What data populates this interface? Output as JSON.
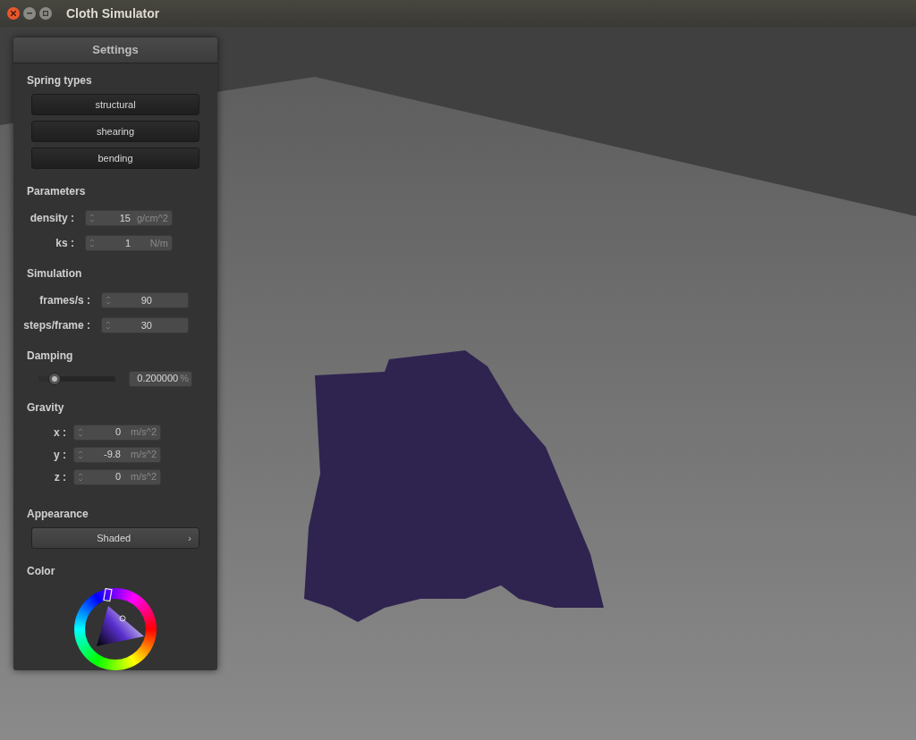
{
  "window": {
    "title": "Cloth Simulator"
  },
  "settings": {
    "title": "Settings",
    "spring_types": {
      "heading": "Spring types",
      "buttons": [
        "structural",
        "shearing",
        "bending"
      ]
    },
    "parameters": {
      "heading": "Parameters",
      "fields": [
        {
          "label": "density :",
          "value": "15",
          "unit": "g/cm^2"
        },
        {
          "label": "ks :",
          "value": "1",
          "unit": "N/m"
        }
      ]
    },
    "simulation": {
      "heading": "Simulation",
      "fields": [
        {
          "label": "frames/s :",
          "value": "90"
        },
        {
          "label": "steps/frame :",
          "value": "30"
        }
      ]
    },
    "damping": {
      "heading": "Damping",
      "level": 0.2,
      "value": "0.200000",
      "unit": "%"
    },
    "gravity": {
      "heading": "Gravity",
      "fields": [
        {
          "label": "x :",
          "value": "0",
          "unit": "m/s^2"
        },
        {
          "label": "y :",
          "value": "-9.8",
          "unit": "m/s^2"
        },
        {
          "label": "z :",
          "value": "0",
          "unit": "m/s^2"
        }
      ]
    },
    "appearance": {
      "heading": "Appearance",
      "value": "Shaded",
      "arrow": "›"
    },
    "color": {
      "heading": "Color"
    }
  }
}
